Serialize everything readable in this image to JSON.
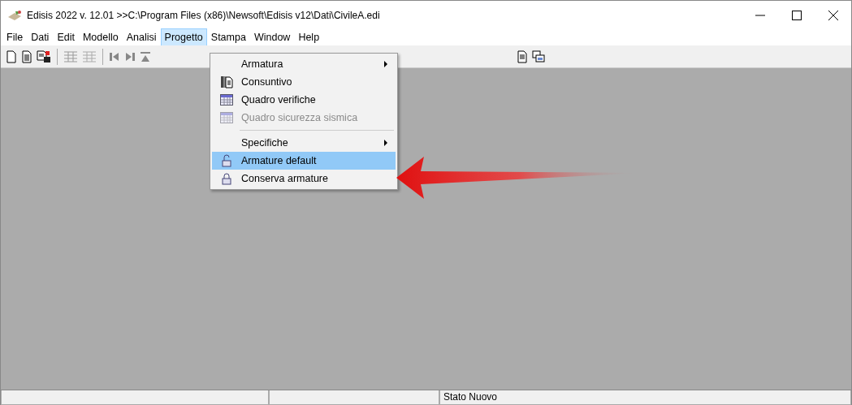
{
  "window": {
    "title": "Edisis 2022 v. 12.01 >>C:\\Program Files (x86)\\Newsoft\\Edisis v12\\Dati\\CivileA.edi"
  },
  "menu_bar": [
    {
      "label": "File",
      "selected": false
    },
    {
      "label": "Dati",
      "selected": false
    },
    {
      "label": "Edit",
      "selected": false
    },
    {
      "label": "Modello",
      "selected": false
    },
    {
      "label": "Analisi",
      "selected": false
    },
    {
      "label": "Progetto",
      "selected": true
    },
    {
      "label": "Stampa",
      "selected": false
    },
    {
      "label": "Window",
      "selected": false
    },
    {
      "label": "Help",
      "selected": false
    }
  ],
  "dropdown": [
    {
      "kind": "plain",
      "label": "Armatura",
      "submenu": true,
      "disabled": false,
      "selected": false
    },
    {
      "kind": "pages",
      "label": "Consuntivo",
      "submenu": false,
      "disabled": false,
      "selected": false
    },
    {
      "kind": "table",
      "label": "Quadro verifiche",
      "submenu": false,
      "disabled": false,
      "selected": false
    },
    {
      "kind": "table",
      "label": "Quadro sicurezza sismica",
      "submenu": false,
      "disabled": true,
      "selected": false
    },
    {
      "kind": "separator"
    },
    {
      "kind": "plain",
      "label": "Specifiche",
      "submenu": true,
      "disabled": false,
      "selected": false
    },
    {
      "kind": "unlock",
      "label": "Armature default",
      "submenu": false,
      "disabled": false,
      "selected": true
    },
    {
      "kind": "lock",
      "label": "Conserva armature",
      "submenu": false,
      "disabled": false,
      "selected": false
    }
  ],
  "status_bar": {
    "text": "Stato Nuovo"
  }
}
